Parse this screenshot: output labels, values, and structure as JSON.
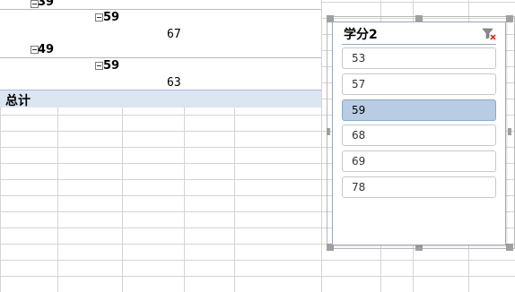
{
  "pivot": {
    "rows": [
      {
        "label": "39"
      },
      {
        "label": "59"
      },
      {
        "label": "67"
      },
      {
        "label": "49"
      },
      {
        "label": "59"
      },
      {
        "label": "63"
      }
    ],
    "total_label": "总计"
  },
  "slicer": {
    "title": "学分2",
    "clear_icon": "clear-filter-icon",
    "items": [
      {
        "label": "53",
        "selected": false
      },
      {
        "label": "57",
        "selected": false
      },
      {
        "label": "59",
        "selected": true
      },
      {
        "label": "68",
        "selected": false
      },
      {
        "label": "69",
        "selected": false
      },
      {
        "label": "78",
        "selected": false
      }
    ],
    "selected_color": "#b8cce4"
  }
}
